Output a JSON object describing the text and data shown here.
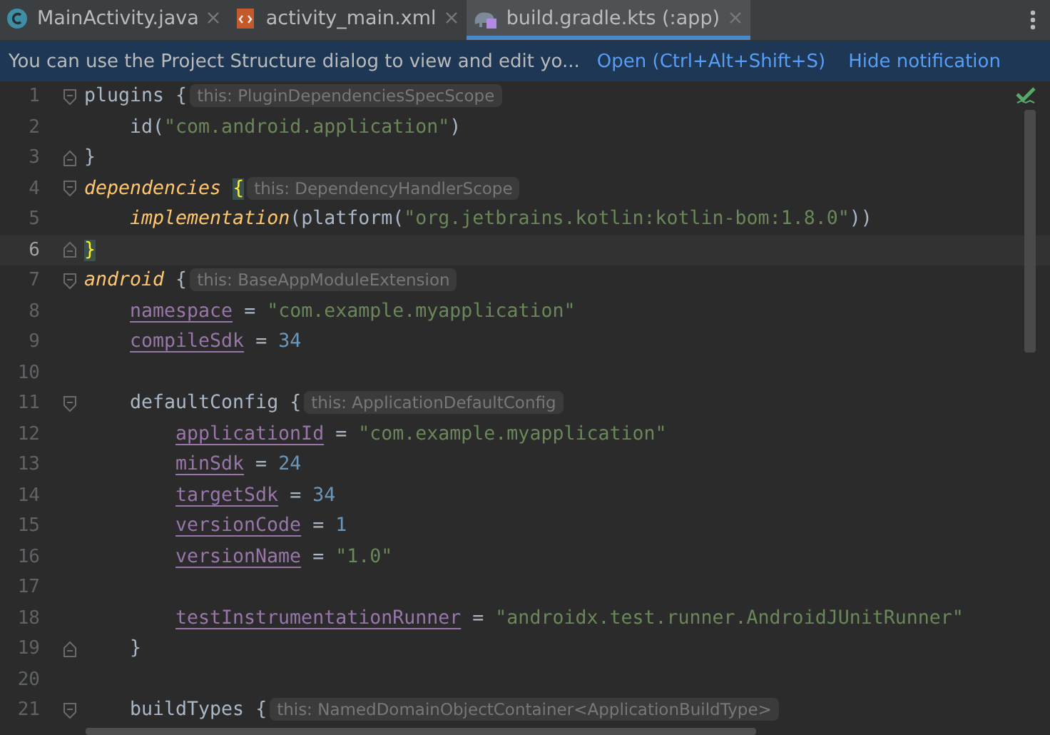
{
  "tabs": [
    {
      "label": "MainActivity.java",
      "kind": "java",
      "selected": false
    },
    {
      "label": "activity_main.xml",
      "kind": "xml",
      "selected": false
    },
    {
      "label": "build.gradle.kts (:app)",
      "kind": "gradle",
      "selected": true
    }
  ],
  "notification": {
    "message": "You can use the Project Structure dialog to view and edit yo...",
    "links": [
      "Open (Ctrl+Alt+Shift+S)",
      "Hide notification"
    ]
  },
  "editor": {
    "lines": [
      {
        "number": "1",
        "kind": "block-start",
        "current": false,
        "tokens": [
          {
            "kind": "plain",
            "text": "plugins "
          },
          {
            "kind": "plain",
            "text": "{"
          },
          {
            "kind": "hint",
            "text": "this: PluginDependenciesSpecScope"
          }
        ],
        "children": [
          {
            "number": "2",
            "kind": "code",
            "current": false,
            "tokens": [
              {
                "kind": "plain",
                "text": "id("
              },
              {
                "kind": "string",
                "text": "\"com.android.application\""
              },
              {
                "kind": "plain",
                "text": ")"
              }
            ]
          }
        ]
      },
      {
        "number": "3",
        "kind": "block-end",
        "current": false,
        "tokens": [
          {
            "kind": "plain",
            "text": "}"
          }
        ]
      },
      {
        "number": "4",
        "kind": "block-start",
        "current": false,
        "tokens": [
          {
            "kind": "call",
            "text": "dependencies "
          },
          {
            "kind": "match",
            "text": "{"
          },
          {
            "kind": "hint",
            "text": "this: DependencyHandlerScope"
          }
        ],
        "children": [
          {
            "number": "5",
            "kind": "code",
            "current": false,
            "tokens": [
              {
                "kind": "call",
                "text": "implementation"
              },
              {
                "kind": "plain",
                "text": "(platform("
              },
              {
                "kind": "string",
                "text": "\"org.jetbrains.kotlin:kotlin-bom:1.8.0\""
              },
              {
                "kind": "plain",
                "text": "))"
              }
            ]
          }
        ]
      },
      {
        "number": "6",
        "kind": "block-end",
        "current": true,
        "tokens": [
          {
            "kind": "match",
            "text": "}"
          }
        ]
      },
      {
        "number": "7",
        "kind": "block-start",
        "current": false,
        "tokens": [
          {
            "kind": "call",
            "text": "android "
          },
          {
            "kind": "plain",
            "text": "{"
          },
          {
            "kind": "hint",
            "text": "this: BaseAppModuleExtension"
          }
        ],
        "children": [
          {
            "number": "8",
            "kind": "code",
            "current": false,
            "tokens": [
              {
                "kind": "prop",
                "text": "namespace"
              },
              {
                "kind": "plain",
                "text": " = "
              },
              {
                "kind": "string",
                "text": "\"com.example.myapplication\""
              }
            ]
          },
          {
            "number": "9",
            "kind": "code",
            "current": false,
            "tokens": [
              {
                "kind": "prop",
                "text": "compileSdk"
              },
              {
                "kind": "plain",
                "text": " = "
              },
              {
                "kind": "number",
                "text": "34"
              }
            ]
          },
          {
            "number": "10",
            "kind": "code",
            "current": false
          },
          {
            "number": "11",
            "kind": "block-start",
            "current": false,
            "tokens": [
              {
                "kind": "plain",
                "text": "defaultConfig "
              },
              {
                "kind": "plain",
                "text": "{"
              },
              {
                "kind": "hint",
                "text": "this: ApplicationDefaultConfig"
              }
            ],
            "children": [
              {
                "number": "12",
                "kind": "code",
                "current": false,
                "tokens": [
                  {
                    "kind": "prop",
                    "text": "applicationId"
                  },
                  {
                    "kind": "plain",
                    "text": " = "
                  },
                  {
                    "kind": "string",
                    "text": "\"com.example.myapplication\""
                  }
                ]
              },
              {
                "number": "13",
                "kind": "code",
                "current": false,
                "tokens": [
                  {
                    "kind": "prop",
                    "text": "minSdk"
                  },
                  {
                    "kind": "plain",
                    "text": " = "
                  },
                  {
                    "kind": "number",
                    "text": "24"
                  }
                ]
              },
              {
                "number": "14",
                "kind": "code",
                "current": false,
                "tokens": [
                  {
                    "kind": "prop",
                    "text": "targetSdk"
                  },
                  {
                    "kind": "plain",
                    "text": " = "
                  },
                  {
                    "kind": "number",
                    "text": "34"
                  }
                ]
              },
              {
                "number": "15",
                "kind": "code",
                "current": false,
                "tokens": [
                  {
                    "kind": "prop",
                    "text": "versionCode"
                  },
                  {
                    "kind": "plain",
                    "text": " = "
                  },
                  {
                    "kind": "number",
                    "text": "1"
                  }
                ]
              },
              {
                "number": "16",
                "kind": "code",
                "current": false,
                "tokens": [
                  {
                    "kind": "prop",
                    "text": "versionName"
                  },
                  {
                    "kind": "plain",
                    "text": " = "
                  },
                  {
                    "kind": "string",
                    "text": "\"1.0\""
                  }
                ]
              },
              {
                "number": "17",
                "kind": "code",
                "current": false
              },
              {
                "number": "18",
                "kind": "code",
                "current": false,
                "tokens": [
                  {
                    "kind": "prop",
                    "text": "testInstrumentationRunner"
                  },
                  {
                    "kind": "plain",
                    "text": " = "
                  },
                  {
                    "kind": "string",
                    "text": "\"androidx.test.runner.AndroidJUnitRunner\""
                  }
                ]
              }
            ]
          },
          {
            "number": "19",
            "kind": "block-end",
            "current": false,
            "tokens": [
              {
                "kind": "plain",
                "text": "}"
              }
            ]
          },
          {
            "number": "20",
            "kind": "code",
            "current": false
          },
          {
            "number": "21",
            "kind": "block-start",
            "current": false,
            "tokens": [
              {
                "kind": "plain",
                "text": "buildTypes "
              },
              {
                "kind": "plain",
                "text": "{"
              },
              {
                "kind": "hint",
                "text": "this: NamedDomainObjectContainer<ApplicationBuildType>"
              }
            ]
          }
        ]
      }
    ]
  }
}
